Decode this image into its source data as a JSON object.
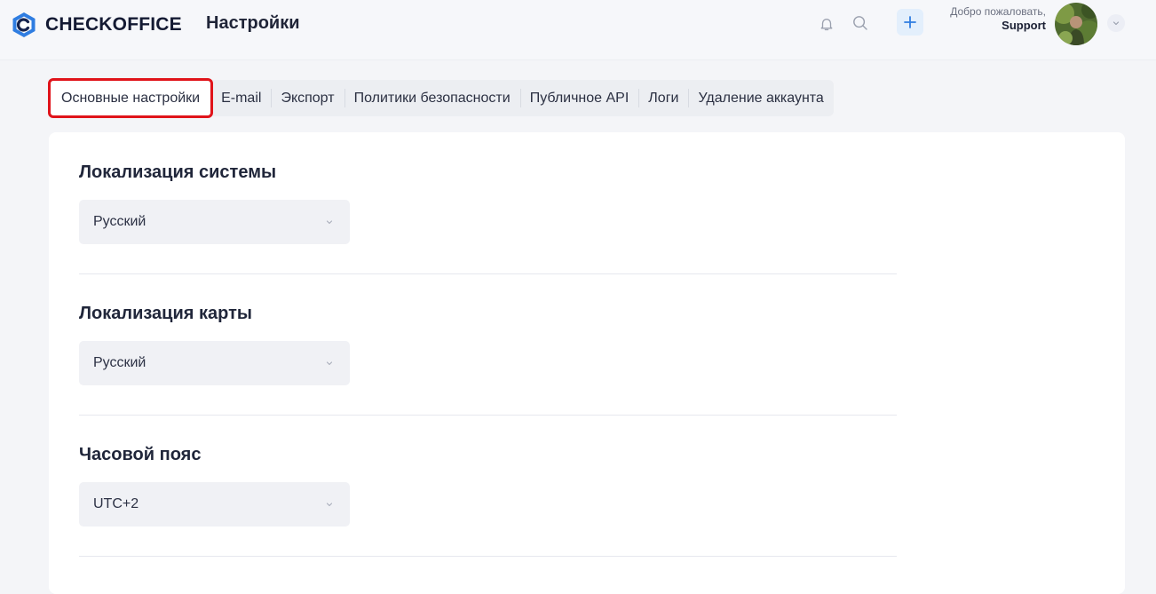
{
  "app": {
    "brand": "CHECKOFFICE",
    "page_title": "Настройки"
  },
  "header": {
    "welcome": "Добро пожаловать,",
    "user": "Support",
    "icons": [
      "bell-icon",
      "search-icon",
      "plus-icon",
      "chevron-down-icon"
    ],
    "accent_color": "#2f7de1"
  },
  "tabs": [
    {
      "label": "Основные настройки",
      "active": true
    },
    {
      "label": "E-mail"
    },
    {
      "label": "Экспорт"
    },
    {
      "label": "Политики безопасности"
    },
    {
      "label": "Публичное API"
    },
    {
      "label": "Логи"
    },
    {
      "label": "Удаление аккаунта"
    }
  ],
  "settings": {
    "system_locale": {
      "title": "Локализация системы",
      "value": "Русский"
    },
    "map_locale": {
      "title": "Локализация карты",
      "value": "Русский"
    },
    "timezone": {
      "title": "Часовой пояс",
      "value": "UTC+2"
    }
  },
  "highlight_color": "#e0131a"
}
